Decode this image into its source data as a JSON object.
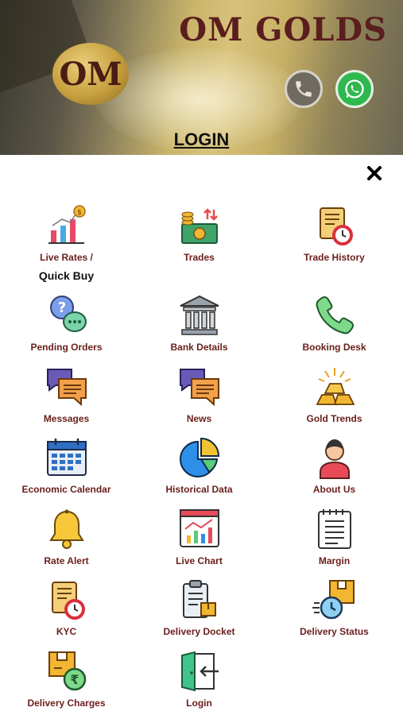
{
  "header": {
    "brand": "OM GOLDS",
    "logo_text": "OM",
    "page_title": "LOGIN"
  },
  "menu": {
    "items": [
      {
        "label": "Live Rates /",
        "label_line2": "Quick Buy",
        "icon": "bar-chart-coin-icon"
      },
      {
        "label": "Trades",
        "icon": "coins-cash-icon"
      },
      {
        "label": "Trade History",
        "icon": "scroll-clock-icon"
      },
      {
        "label": "Pending Orders",
        "icon": "question-chat-icon"
      },
      {
        "label": "Bank Details",
        "icon": "bank-icon"
      },
      {
        "label": "Booking Desk",
        "icon": "phone-icon"
      },
      {
        "label": "Messages",
        "icon": "chat-bubbles-icon"
      },
      {
        "label": "News",
        "icon": "chat-bubbles-icon"
      },
      {
        "label": "Gold Trends",
        "icon": "gold-bars-icon"
      },
      {
        "label": "Economic Calendar",
        "icon": "calendar-icon"
      },
      {
        "label": "Historical Data",
        "icon": "pie-chart-icon"
      },
      {
        "label": "About Us",
        "icon": "person-icon"
      },
      {
        "label": "Rate Alert",
        "icon": "bell-icon"
      },
      {
        "label": "Live Chart",
        "icon": "line-chart-icon"
      },
      {
        "label": "Margin",
        "icon": "notepad-icon"
      },
      {
        "label": "KYC",
        "icon": "scroll-clock-icon"
      },
      {
        "label": "Delivery Docket",
        "icon": "clipboard-box-icon"
      },
      {
        "label": "Delivery Status",
        "icon": "box-clock-icon"
      },
      {
        "label": "Delivery Charges",
        "icon": "box-rupee-icon"
      },
      {
        "label": "Login",
        "icon": "login-door-icon"
      }
    ]
  },
  "colors": {
    "label": "#6a1e1a",
    "accent": "#5a1e1e",
    "whatsapp": "#2fb84f"
  }
}
